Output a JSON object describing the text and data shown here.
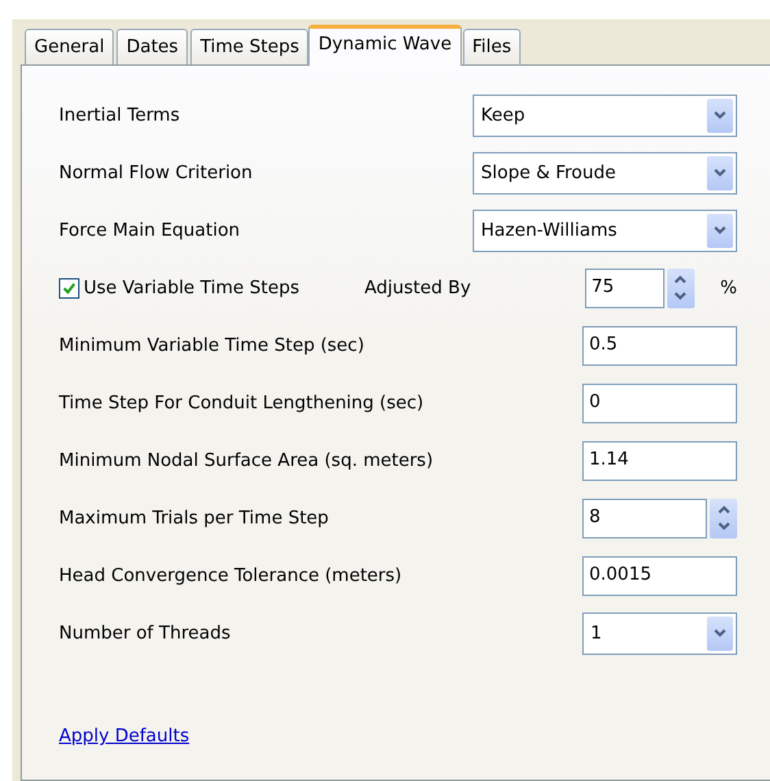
{
  "tabs": [
    {
      "label": "General",
      "selected": false
    },
    {
      "label": "Dates",
      "selected": false
    },
    {
      "label": "Time Steps",
      "selected": false
    },
    {
      "label": "Dynamic Wave",
      "selected": true
    },
    {
      "label": "Files",
      "selected": false
    }
  ],
  "settings": [
    {
      "kind": "select",
      "label": "Inertial Terms",
      "value": "Keep"
    },
    {
      "kind": "select",
      "label": "Normal Flow Criterion",
      "value": "Slope & Froude"
    },
    {
      "kind": "select",
      "label": "Force Main Equation",
      "value": "Hazen-Williams"
    },
    {
      "kind": "check_spin",
      "label": "Use Variable Time Steps",
      "checked": true,
      "sublabel": "Adjusted By",
      "value": "75",
      "unit": "%"
    },
    {
      "kind": "text",
      "label": "Minimum Variable Time Step (sec)",
      "value": "0.5"
    },
    {
      "kind": "text",
      "label": "Time Step For Conduit Lengthening (sec)",
      "value": "0"
    },
    {
      "kind": "text",
      "label": "Minimum Nodal Surface Area (sq. meters)",
      "value": "1.14"
    },
    {
      "kind": "spin",
      "label": "Maximum Trials per Time Step",
      "value": "8"
    },
    {
      "kind": "text",
      "label": "Head Convergence Tolerance (meters)",
      "value": "0.0015"
    },
    {
      "kind": "select_short",
      "label": "Number of Threads",
      "value": "1"
    }
  ],
  "link": "Apply Defaults"
}
